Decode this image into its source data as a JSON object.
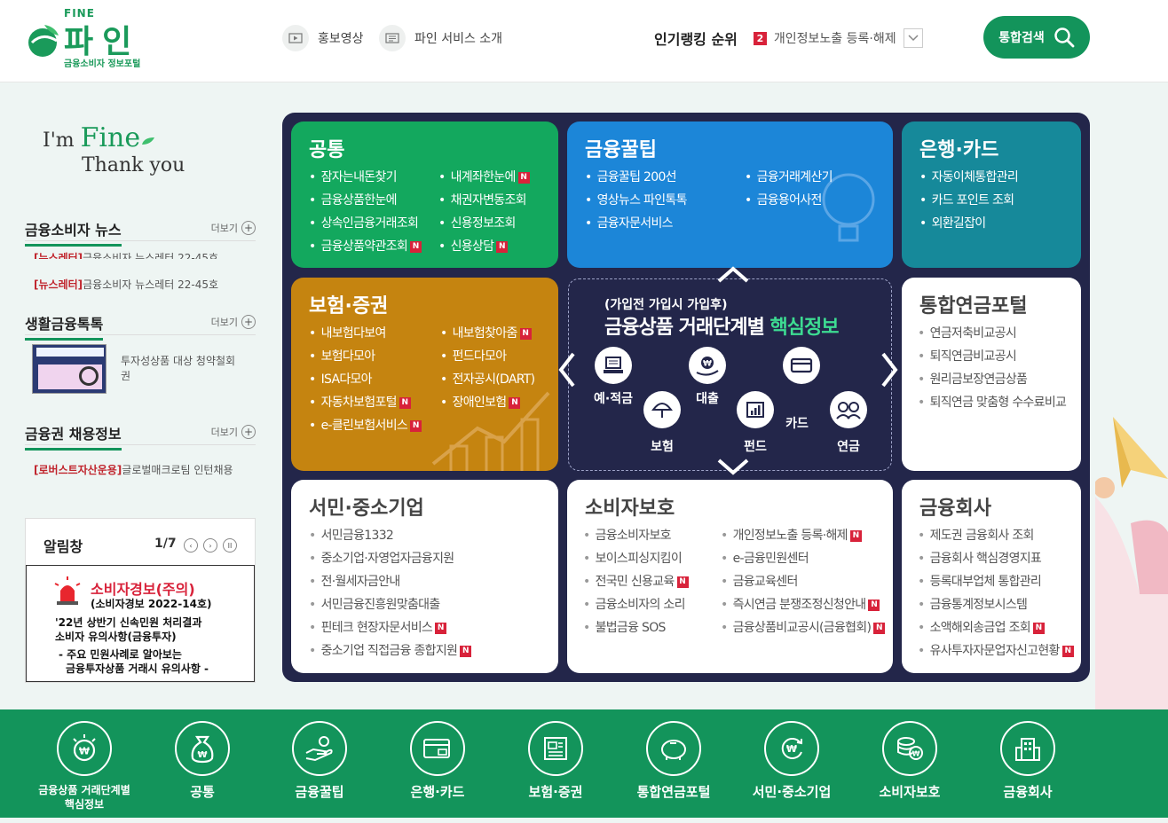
{
  "header": {
    "logo": {
      "fine": "FINE",
      "name": "파인",
      "sub": "금융소비자 정보포털"
    },
    "links": [
      {
        "label": "홍보영상",
        "icon": "play-icon"
      },
      {
        "label": "파인 서비스 소개",
        "icon": "document-icon"
      }
    ],
    "ranking": {
      "title": "인기랭킹 순위",
      "num": "2",
      "text": "개인정보노출 등록·해제"
    },
    "search_label": "통합검색"
  },
  "sidebar": {
    "slogan1_prefix": "I'm ",
    "slogan1_fine": "Fine",
    "slogan2": "Thank you",
    "news": {
      "title": "금융소비자 뉴스",
      "more": "더보기",
      "items": [
        {
          "tag": "[뉴스레터]",
          "text": "금융소비자 뉴스레터 22-45호"
        },
        {
          "tag": "[뉴스레터]",
          "text": "금융소비자 뉴스레터 22-45호"
        }
      ]
    },
    "life": {
      "title": "생활금융톡톡",
      "more": "더보기",
      "text": "투자성상품 대상 청약철회권"
    },
    "jobs": {
      "title": "금융권 채용정보",
      "more": "더보기",
      "tag": "[로버스트자산운용]",
      "text": "글로벌매크로팀 인턴채용"
    },
    "alert": {
      "title": "알림창",
      "page": "1/7",
      "head": "소비자경보(주의)",
      "sub": "(소비자경보 2022-14호)",
      "line1": "'22년 상반기 신속민원 처리결과",
      "line2": "소비자 유의사항(금융투자)",
      "line3": "- 주요 민원사례로 알아보는",
      "line4": "금융투자상품 거래시 유의사항 -"
    }
  },
  "tiles": {
    "common": {
      "title": "공통",
      "col1": [
        {
          "t": "잠자는내돈찾기"
        },
        {
          "t": "금융상품한눈에"
        },
        {
          "t": "상속인금융거래조회"
        },
        {
          "t": "금융상품약관조회",
          "n": true
        }
      ],
      "col2": [
        {
          "t": "내계좌한눈에",
          "n": true
        },
        {
          "t": "채권자변동조회"
        },
        {
          "t": "신용정보조회"
        },
        {
          "t": "신용상담",
          "n": true
        }
      ]
    },
    "tips": {
      "title": "금융꿀팁",
      "col1": [
        {
          "t": "금융꿀팁 200선"
        },
        {
          "t": "영상뉴스 파인톡톡"
        },
        {
          "t": "금융자문서비스"
        }
      ],
      "col2": [
        {
          "t": "금융거래계산기"
        },
        {
          "t": "금융용어사전"
        }
      ]
    },
    "bank": {
      "title": "은행·카드",
      "col1": [
        {
          "t": "자동이체통합관리"
        },
        {
          "t": "카드 포인트 조회"
        },
        {
          "t": "외환길잡이"
        }
      ]
    },
    "insurance": {
      "title": "보험·증권",
      "col1": [
        {
          "t": "내보험다보여"
        },
        {
          "t": "보험다모아"
        },
        {
          "t": "ISA다모아"
        },
        {
          "t": "자동차보험포털",
          "n": true
        },
        {
          "t": "e-클린보험서비스",
          "n": true
        }
      ],
      "col2": [
        {
          "t": "내보험찾아줌",
          "n": true
        },
        {
          "t": "펀드다모아"
        },
        {
          "t": "전자공시(DART)"
        },
        {
          "t": "장애인보험",
          "n": true
        }
      ]
    },
    "pension": {
      "title": "통합연금포털",
      "col1": [
        {
          "t": "연금저축비교공시"
        },
        {
          "t": "퇴직연금비교공시"
        },
        {
          "t": "원리금보장연금상품"
        },
        {
          "t": "퇴직연금 맞춤형 수수료비교"
        }
      ]
    },
    "sme": {
      "title": "서민·중소기업",
      "col1": [
        {
          "t": "서민금융1332"
        },
        {
          "t": "중소기업·자영업자금융지원"
        },
        {
          "t": "전·월세자금안내"
        },
        {
          "t": "서민금융진흥원맞춤대출"
        },
        {
          "t": "핀테크 현장자문서비스",
          "n": true
        },
        {
          "t": "중소기업 직접금융 종합지원",
          "n": true
        }
      ]
    },
    "consumer": {
      "title": "소비자보호",
      "col1": [
        {
          "t": "금융소비자보호"
        },
        {
          "t": "보이스피싱지킴이"
        },
        {
          "t": "전국민 신용교육",
          "n": true
        },
        {
          "t": "금융소비자의 소리"
        },
        {
          "t": "불법금융 SOS"
        }
      ],
      "col2": [
        {
          "t": "개인정보노출 등록·해제",
          "n": true
        },
        {
          "t": "e-금융민원센터"
        },
        {
          "t": "금융교육센터"
        },
        {
          "t": "즉시연금 분쟁조정신청안내",
          "n": true
        },
        {
          "t": "금융상품비교공시(금융협회)",
          "n": true
        }
      ]
    },
    "company": {
      "title": "금융회사",
      "col1": [
        {
          "t": "제도권 금융회사 조회"
        },
        {
          "t": "금융회사 핵심경영지표"
        },
        {
          "t": "등록대부업체 통합관리"
        },
        {
          "t": "금융통계정보시스템"
        },
        {
          "t": "소액해외송금업 조회",
          "n": true
        },
        {
          "t": "유사투자자문업자신고현황",
          "n": true
        }
      ]
    }
  },
  "center": {
    "line1": "(가입전 가입시 가입후)",
    "line2_prefix": "금융상품 거래단계별 ",
    "line2_highlight": "핵심정보",
    "cats": [
      {
        "label": "예·적금",
        "icon": "laptop-icon"
      },
      {
        "label": "대출",
        "icon": "loan-hand-icon"
      },
      {
        "label": "카드",
        "icon": "card-icon"
      },
      {
        "label": "보험",
        "icon": "umbrella-icon"
      },
      {
        "label": "펀드",
        "icon": "fund-chart-icon"
      },
      {
        "label": "연금",
        "icon": "pension-couple-icon"
      }
    ]
  },
  "new_badge": "N",
  "bottom": {
    "items": [
      {
        "label1": "금융상품 거래단계별",
        "label2": "핵심정보",
        "icon": "lightbulb-won-icon"
      },
      {
        "label1": "공통",
        "icon": "money-bag-icon"
      },
      {
        "label1": "금융꿀팁",
        "icon": "hand-coin-icon"
      },
      {
        "label1": "은행·카드",
        "icon": "card-icon"
      },
      {
        "label1": "보험·증권",
        "icon": "newspaper-icon"
      },
      {
        "label1": "통합연금포털",
        "icon": "piggy-bank-icon"
      },
      {
        "label1": "서민·중소기업",
        "icon": "won-cycle-icon"
      },
      {
        "label1": "소비자보호",
        "icon": "coins-shield-icon"
      },
      {
        "label1": "금융회사",
        "icon": "building-icon"
      }
    ]
  },
  "colors": {
    "brand": "#13945b",
    "common": "#13a85e",
    "tips": "#1c86d8",
    "bank": "#16899a",
    "insurance": "#c58410",
    "panel": "#23264a",
    "new": "#d8223a"
  }
}
